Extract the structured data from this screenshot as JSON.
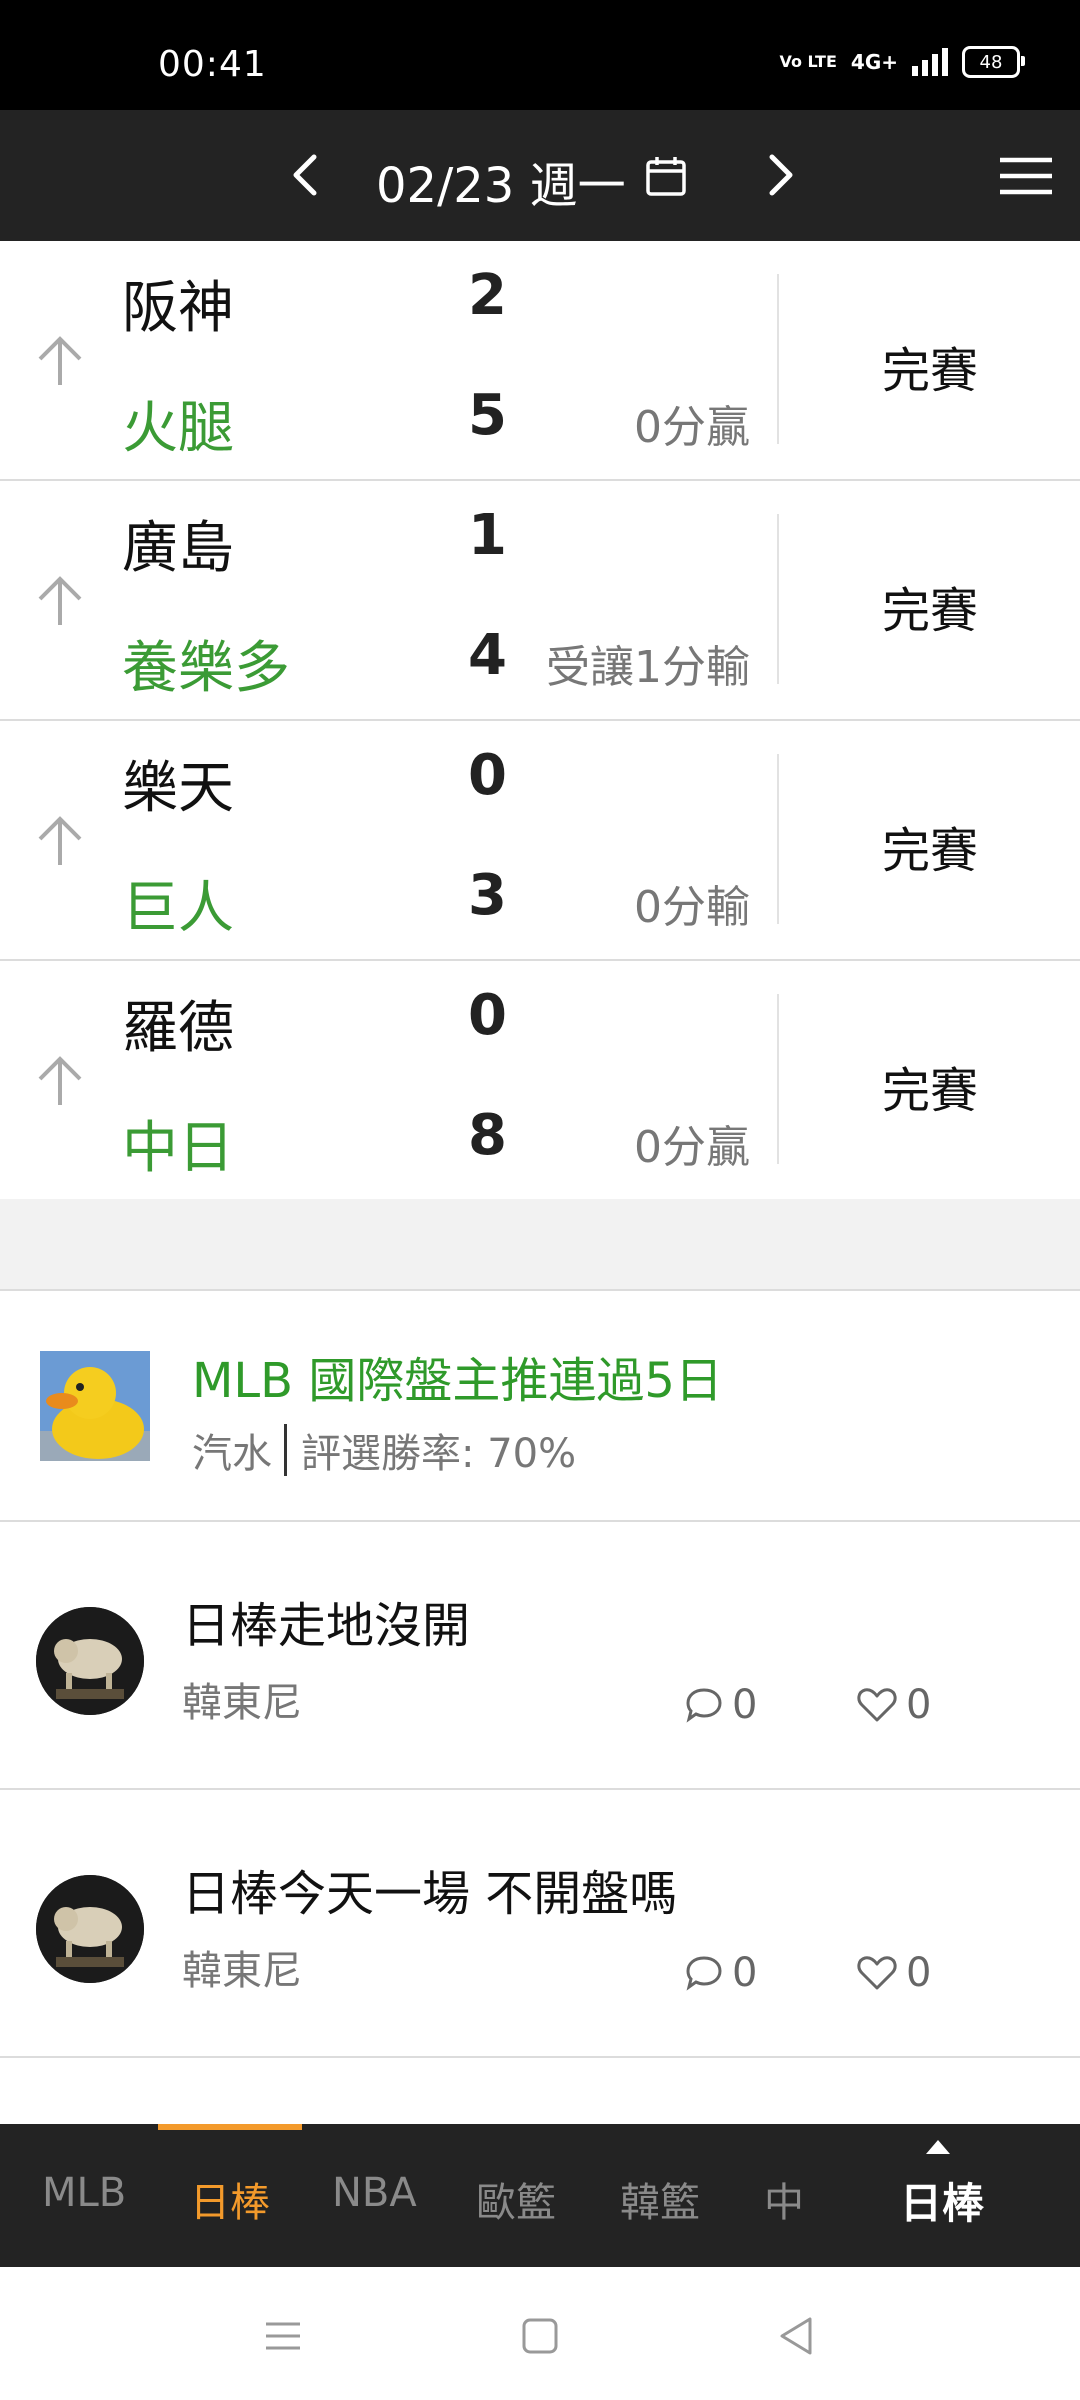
{
  "status_bar": {
    "time": "00:41",
    "volte": "Vo LTE",
    "network": "4G+",
    "battery": "48"
  },
  "header": {
    "date": "02/23 週一"
  },
  "games": [
    {
      "away": "阪神",
      "away_score": "2",
      "home": "火腿",
      "home_score": "5",
      "result": "0分贏",
      "status": "完賽"
    },
    {
      "away": "廣島",
      "away_score": "1",
      "home": "養樂多",
      "home_score": "4",
      "result": "受讓1分輸",
      "status": "完賽"
    },
    {
      "away": "樂天",
      "away_score": "0",
      "home": "巨人",
      "home_score": "3",
      "result": "0分輸",
      "status": "完賽"
    },
    {
      "away": "羅德",
      "away_score": "0",
      "home": "中日",
      "home_score": "8",
      "result": "0分贏",
      "status": "完賽"
    }
  ],
  "featured": {
    "title": "MLB 國際盤主推連過5日",
    "author": "汽水",
    "win_rate": "評選勝率: 70%"
  },
  "posts": [
    {
      "title": "日棒走地沒開",
      "author": "韓東尼",
      "comments": "0",
      "likes": "0"
    },
    {
      "title": "日棒今天一場 不開盤嗎",
      "author": "韓東尼",
      "comments": "0",
      "likes": "0"
    }
  ],
  "tabs": [
    {
      "label": "MLB"
    },
    {
      "label": "日棒"
    },
    {
      "label": "NBA"
    },
    {
      "label": "歐籃"
    },
    {
      "label": "韓籃"
    },
    {
      "label": "中"
    }
  ],
  "current_tab": "日棒",
  "colors": {
    "accent": "#f39a2b",
    "home_team": "#3b9b35",
    "header_bg": "#232323"
  }
}
